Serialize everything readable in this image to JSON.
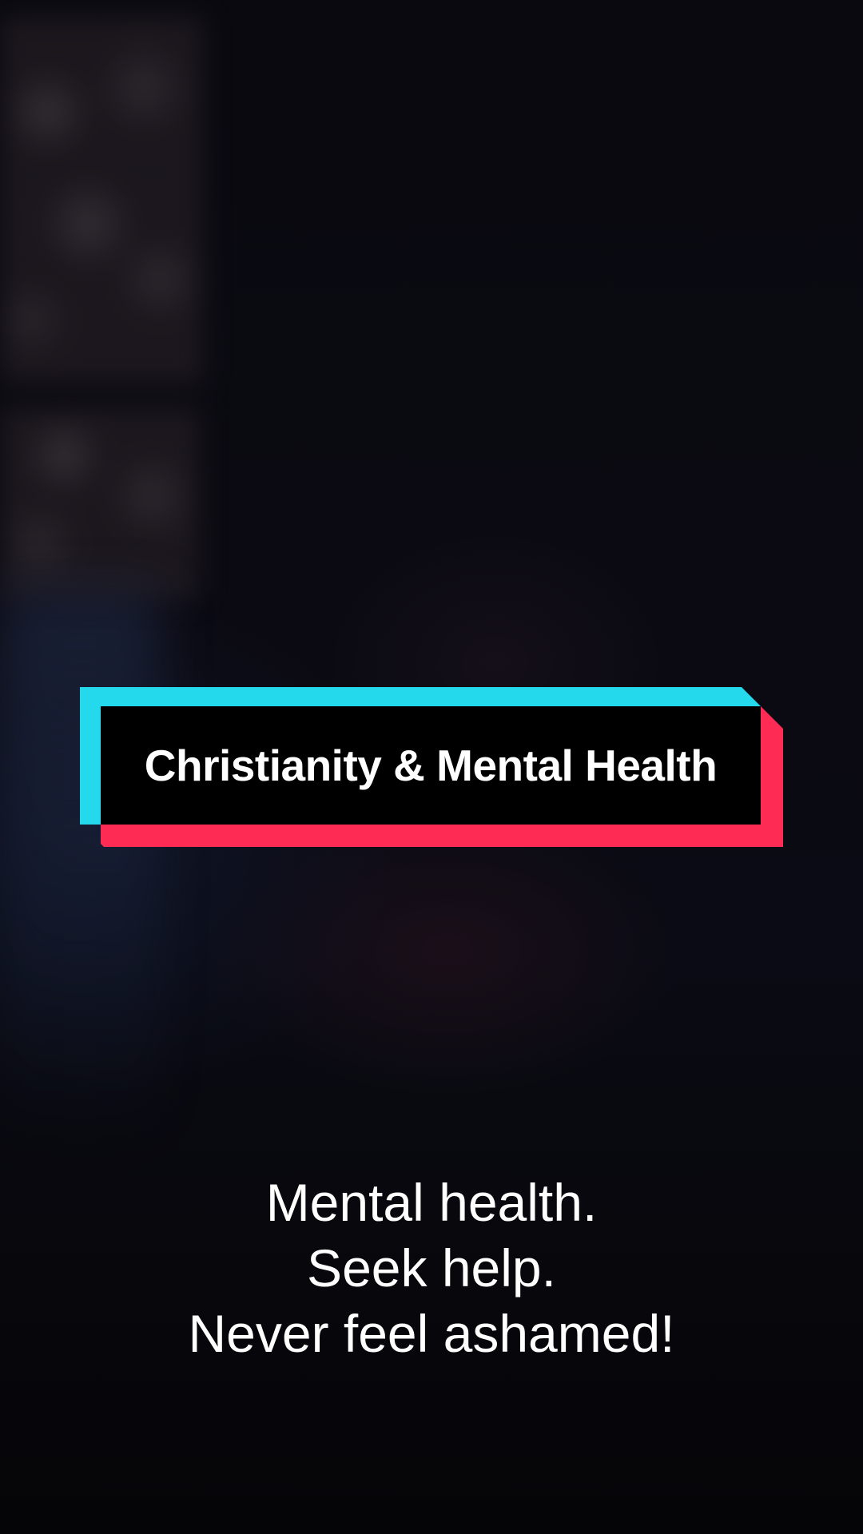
{
  "video": {
    "title_banner": {
      "text": "Christianity & Mental Health",
      "colors": {
        "cyan": "#25d9ec",
        "red": "#fe2c55",
        "fill": "#000000",
        "text": "#ffffff"
      }
    },
    "caption": {
      "lines": [
        "Mental health.",
        "Seek help.",
        "Never feel ashamed!"
      ],
      "color": "#ffffff"
    }
  }
}
